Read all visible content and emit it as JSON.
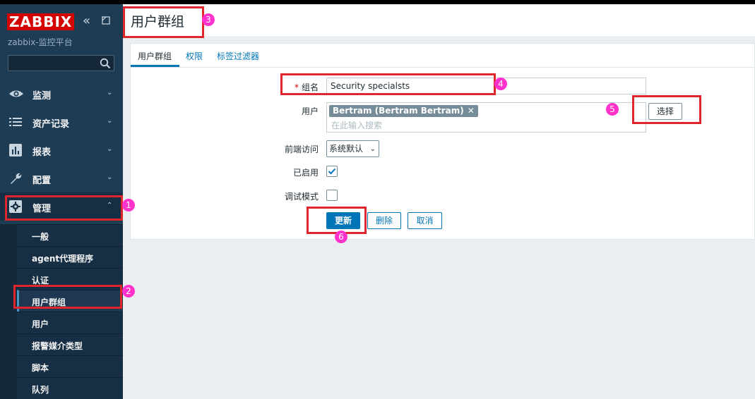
{
  "sidebar": {
    "logo": "ZABBIX",
    "subtitle": "zabbix-监控平台",
    "search_value": "",
    "nav": [
      {
        "label": "监测",
        "icon": "eye-icon",
        "caret": "⌄"
      },
      {
        "label": "资产记录",
        "icon": "list-icon",
        "caret": "⌄"
      },
      {
        "label": "报表",
        "icon": "bar-chart-icon",
        "caret": "⌄"
      },
      {
        "label": "配置",
        "icon": "wrench-icon",
        "caret": "⌄"
      },
      {
        "label": "管理",
        "icon": "gear-icon",
        "caret": "⌃"
      }
    ],
    "submenu": [
      "一般",
      "agent代理程序",
      "认证",
      "用户群组",
      "用户",
      "报警媒介类型",
      "脚本",
      "队列"
    ]
  },
  "header": {
    "title": "用户群组"
  },
  "tabs": [
    "用户群组",
    "权限",
    "标签过滤器"
  ],
  "form": {
    "group_name_label": "组名",
    "group_name_value": "Security specialsts",
    "users_label": "用户",
    "user_tag": "Bertram (Bertram Bertram)",
    "user_tag_remove": "✕",
    "users_placeholder": "在此输入搜索",
    "select_button": "选择",
    "frontend_access_label": "前端访问",
    "frontend_access_value": "系统默认",
    "enabled_label": "已启用",
    "enabled": true,
    "debug_label": "调试模式",
    "debug": false,
    "update_button": "更新",
    "delete_button": "删除",
    "cancel_button": "取消"
  },
  "annotations": [
    "1",
    "2",
    "3",
    "4",
    "5",
    "6"
  ],
  "colors": {
    "sidebar": "#1f3c55",
    "accent": "#0275b8",
    "logo": "#d40000",
    "annotation_box": "#e0262d",
    "annotation_badge": "#ff33cc"
  }
}
